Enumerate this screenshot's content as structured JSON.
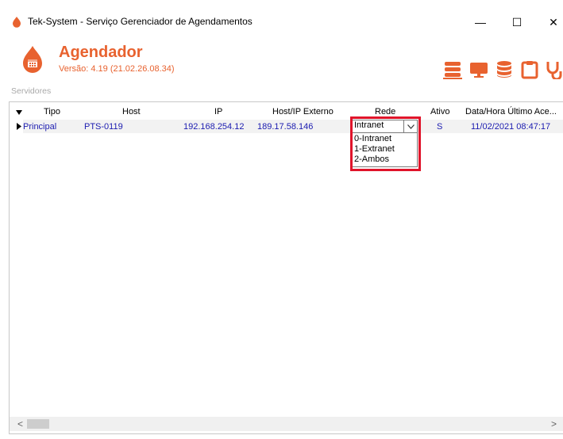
{
  "window": {
    "title": "Tek-System - Serviço Gerenciador de Agendamentos",
    "controls": {
      "minimize": "—",
      "maximize": "☐",
      "close": "✕"
    }
  },
  "header": {
    "app_name": "Agendador",
    "version": "Versão: 4.19 (21.02.26.08.34)",
    "accent_color": "#e8622f",
    "toolbar_icons": [
      "server-icon",
      "monitor-icon",
      "database-icon",
      "clipboard-icon",
      "stethoscope-icon"
    ]
  },
  "section_label": "Servidores",
  "grid": {
    "columns": [
      "Tipo",
      "Host",
      "IP",
      "Host/IP Externo",
      "Rede",
      "Ativo",
      "Data/Hora Último Ace..."
    ],
    "rows": [
      {
        "tipo": "Principal",
        "host": "PTS-0119",
        "ip": "192.168.254.12",
        "ip_externo": "189.17.58.146",
        "rede": "Intranet",
        "ativo": "S",
        "ultimo_acesso": "11/02/2021 08:47:17"
      }
    ],
    "rede_options": [
      "0-Intranet",
      "1-Extranet",
      "2-Ambos"
    ]
  },
  "scrollbar": {
    "left": "<",
    "right": ">"
  }
}
